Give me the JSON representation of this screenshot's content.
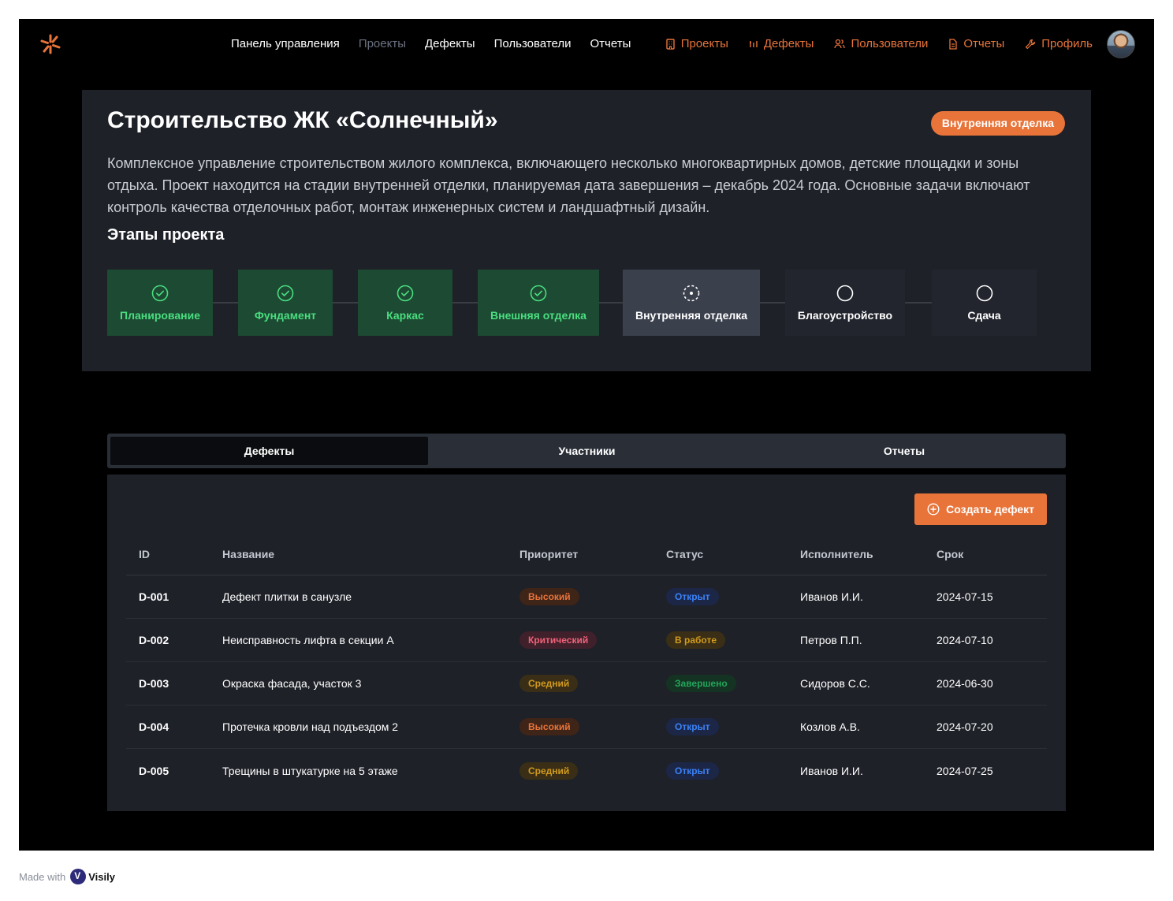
{
  "nav": {
    "links": [
      "Панель управления",
      "Проекты",
      "Дефекты",
      "Пользователи",
      "Отчеты"
    ],
    "active_link_index": 1,
    "accent_links": [
      {
        "label": "Проекты",
        "icon": "building-icon"
      },
      {
        "label": "Дефекты",
        "icon": "wrench-lines-icon"
      },
      {
        "label": "Пользователи",
        "icon": "users-icon"
      },
      {
        "label": "Отчеты",
        "icon": "document-icon"
      },
      {
        "label": "Профиль",
        "icon": "tool-icon"
      }
    ]
  },
  "project": {
    "title": "Строительство ЖК «Солнечный»",
    "stage_badge": "Внутренняя отделка",
    "description": "Комплексное управление строительством жилого комплекса, включающего несколько многоквартирных домов, детские площадки и зоны отдыха. Проект находится на стадии внутренней отделки, планируемая дата завершения – декабрь 2024 года. Основные задачи включают контроль качества отделочных работ, монтаж инженерных систем и ландшафтный дизайн.",
    "stages_title": "Этапы проекта",
    "stages": [
      {
        "label": "Планирование",
        "state": "done"
      },
      {
        "label": "Фундамент",
        "state": "done"
      },
      {
        "label": "Каркас",
        "state": "done"
      },
      {
        "label": "Внешняя отделка",
        "state": "done"
      },
      {
        "label": "Внутренняя отделка",
        "state": "current"
      },
      {
        "label": "Благоустройство",
        "state": "todo"
      },
      {
        "label": "Сдача",
        "state": "todo"
      }
    ]
  },
  "tabs": [
    {
      "label": "Дефекты",
      "active": true
    },
    {
      "label": "Участники",
      "active": false
    },
    {
      "label": "Отчеты",
      "active": false
    }
  ],
  "defects": {
    "create_label": "Создать дефект",
    "columns": [
      "ID",
      "Название",
      "Приоритет",
      "Статус",
      "Исполнитель",
      "Срок"
    ],
    "rows": [
      {
        "id": "D-001",
        "name": "Дефект плитки в санузле",
        "priority": "Высокий",
        "status": "Открыт",
        "assignee": "Иванов И.И.",
        "due": "2024-07-15"
      },
      {
        "id": "D-002",
        "name": "Неисправность лифта в секции А",
        "priority": "Критический",
        "status": "В работе",
        "assignee": "Петров П.П.",
        "due": "2024-07-10"
      },
      {
        "id": "D-003",
        "name": "Окраска фасада, участок 3",
        "priority": "Средний",
        "status": "Завершено",
        "assignee": "Сидоров С.С.",
        "due": "2024-06-30"
      },
      {
        "id": "D-004",
        "name": "Протечка кровли над подъездом 2",
        "priority": "Высокий",
        "status": "Открыт",
        "assignee": "Козлов А.В.",
        "due": "2024-07-20"
      },
      {
        "id": "D-005",
        "name": "Трещины в штукатурке на 5 этаже",
        "priority": "Средний",
        "status": "Открыт",
        "assignee": "Иванов И.И.",
        "due": "2024-07-25"
      }
    ]
  },
  "footer": {
    "made_with": "Made with",
    "brand": "Visily"
  },
  "colors": {
    "accent": "#e8743a",
    "done": "#4ade80",
    "background": "#000000",
    "card": "#1e2128"
  }
}
